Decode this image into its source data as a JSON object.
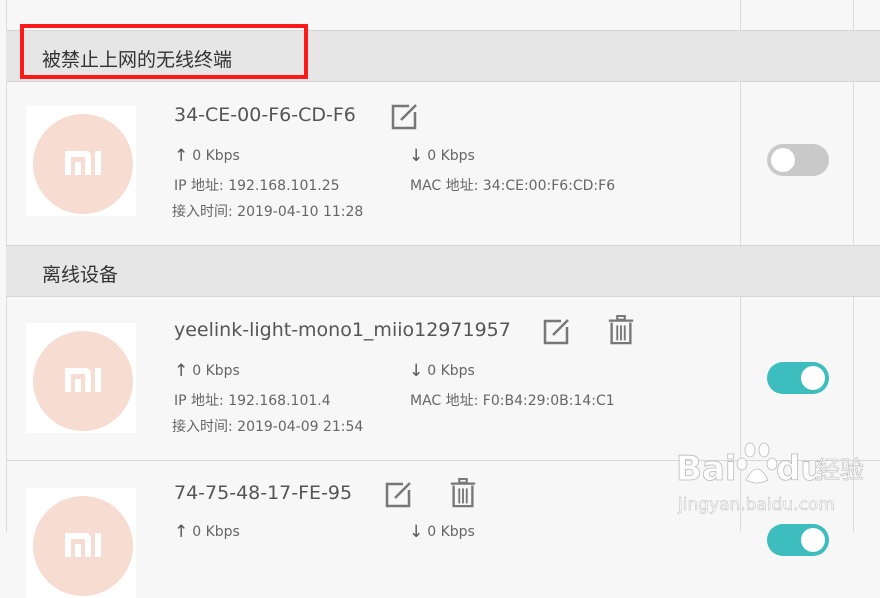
{
  "sections": {
    "blocked_title": "被禁止上网的无线终端",
    "offline_title": "离线设备"
  },
  "devices": [
    {
      "name": "34-CE-00-F6-CD-F6",
      "up": "0 Kbps",
      "down": "0 Kbps",
      "ip": "IP 地址: 192.168.101.25",
      "mac": "MAC 地址: 34:CE:00:F6:CD:F6",
      "time": "接入时间:  2019-04-10 11:28",
      "toggle_on": false
    },
    {
      "name": "yeelink-light-mono1_miio12971957",
      "up": "0 Kbps",
      "down": "0 Kbps",
      "ip": "IP 地址: 192.168.101.4",
      "mac": "MAC 地址: F0:B4:29:0B:14:C1",
      "time": "接入时间:  2019-04-09 21:54",
      "toggle_on": true
    },
    {
      "name": "74-75-48-17-FE-95",
      "up": "0 Kbps",
      "down": "0 Kbps",
      "toggle_on": true
    }
  ],
  "icons": {
    "avatar": "mi-logo-icon",
    "edit": "edit-icon",
    "delete": "trash-icon",
    "upload": "arrow-up-icon",
    "download": "arrow-down-icon"
  },
  "colors": {
    "highlight": "#ff1a1a",
    "toggle_on": "#3dbdbd",
    "toggle_off": "#c9c9c9",
    "avatar_bg": "#f7dcd1"
  },
  "watermark": {
    "brand": "Bai",
    "brand_tail": "du",
    "suffix": "经验",
    "url": "jingyan.baidu.com"
  }
}
